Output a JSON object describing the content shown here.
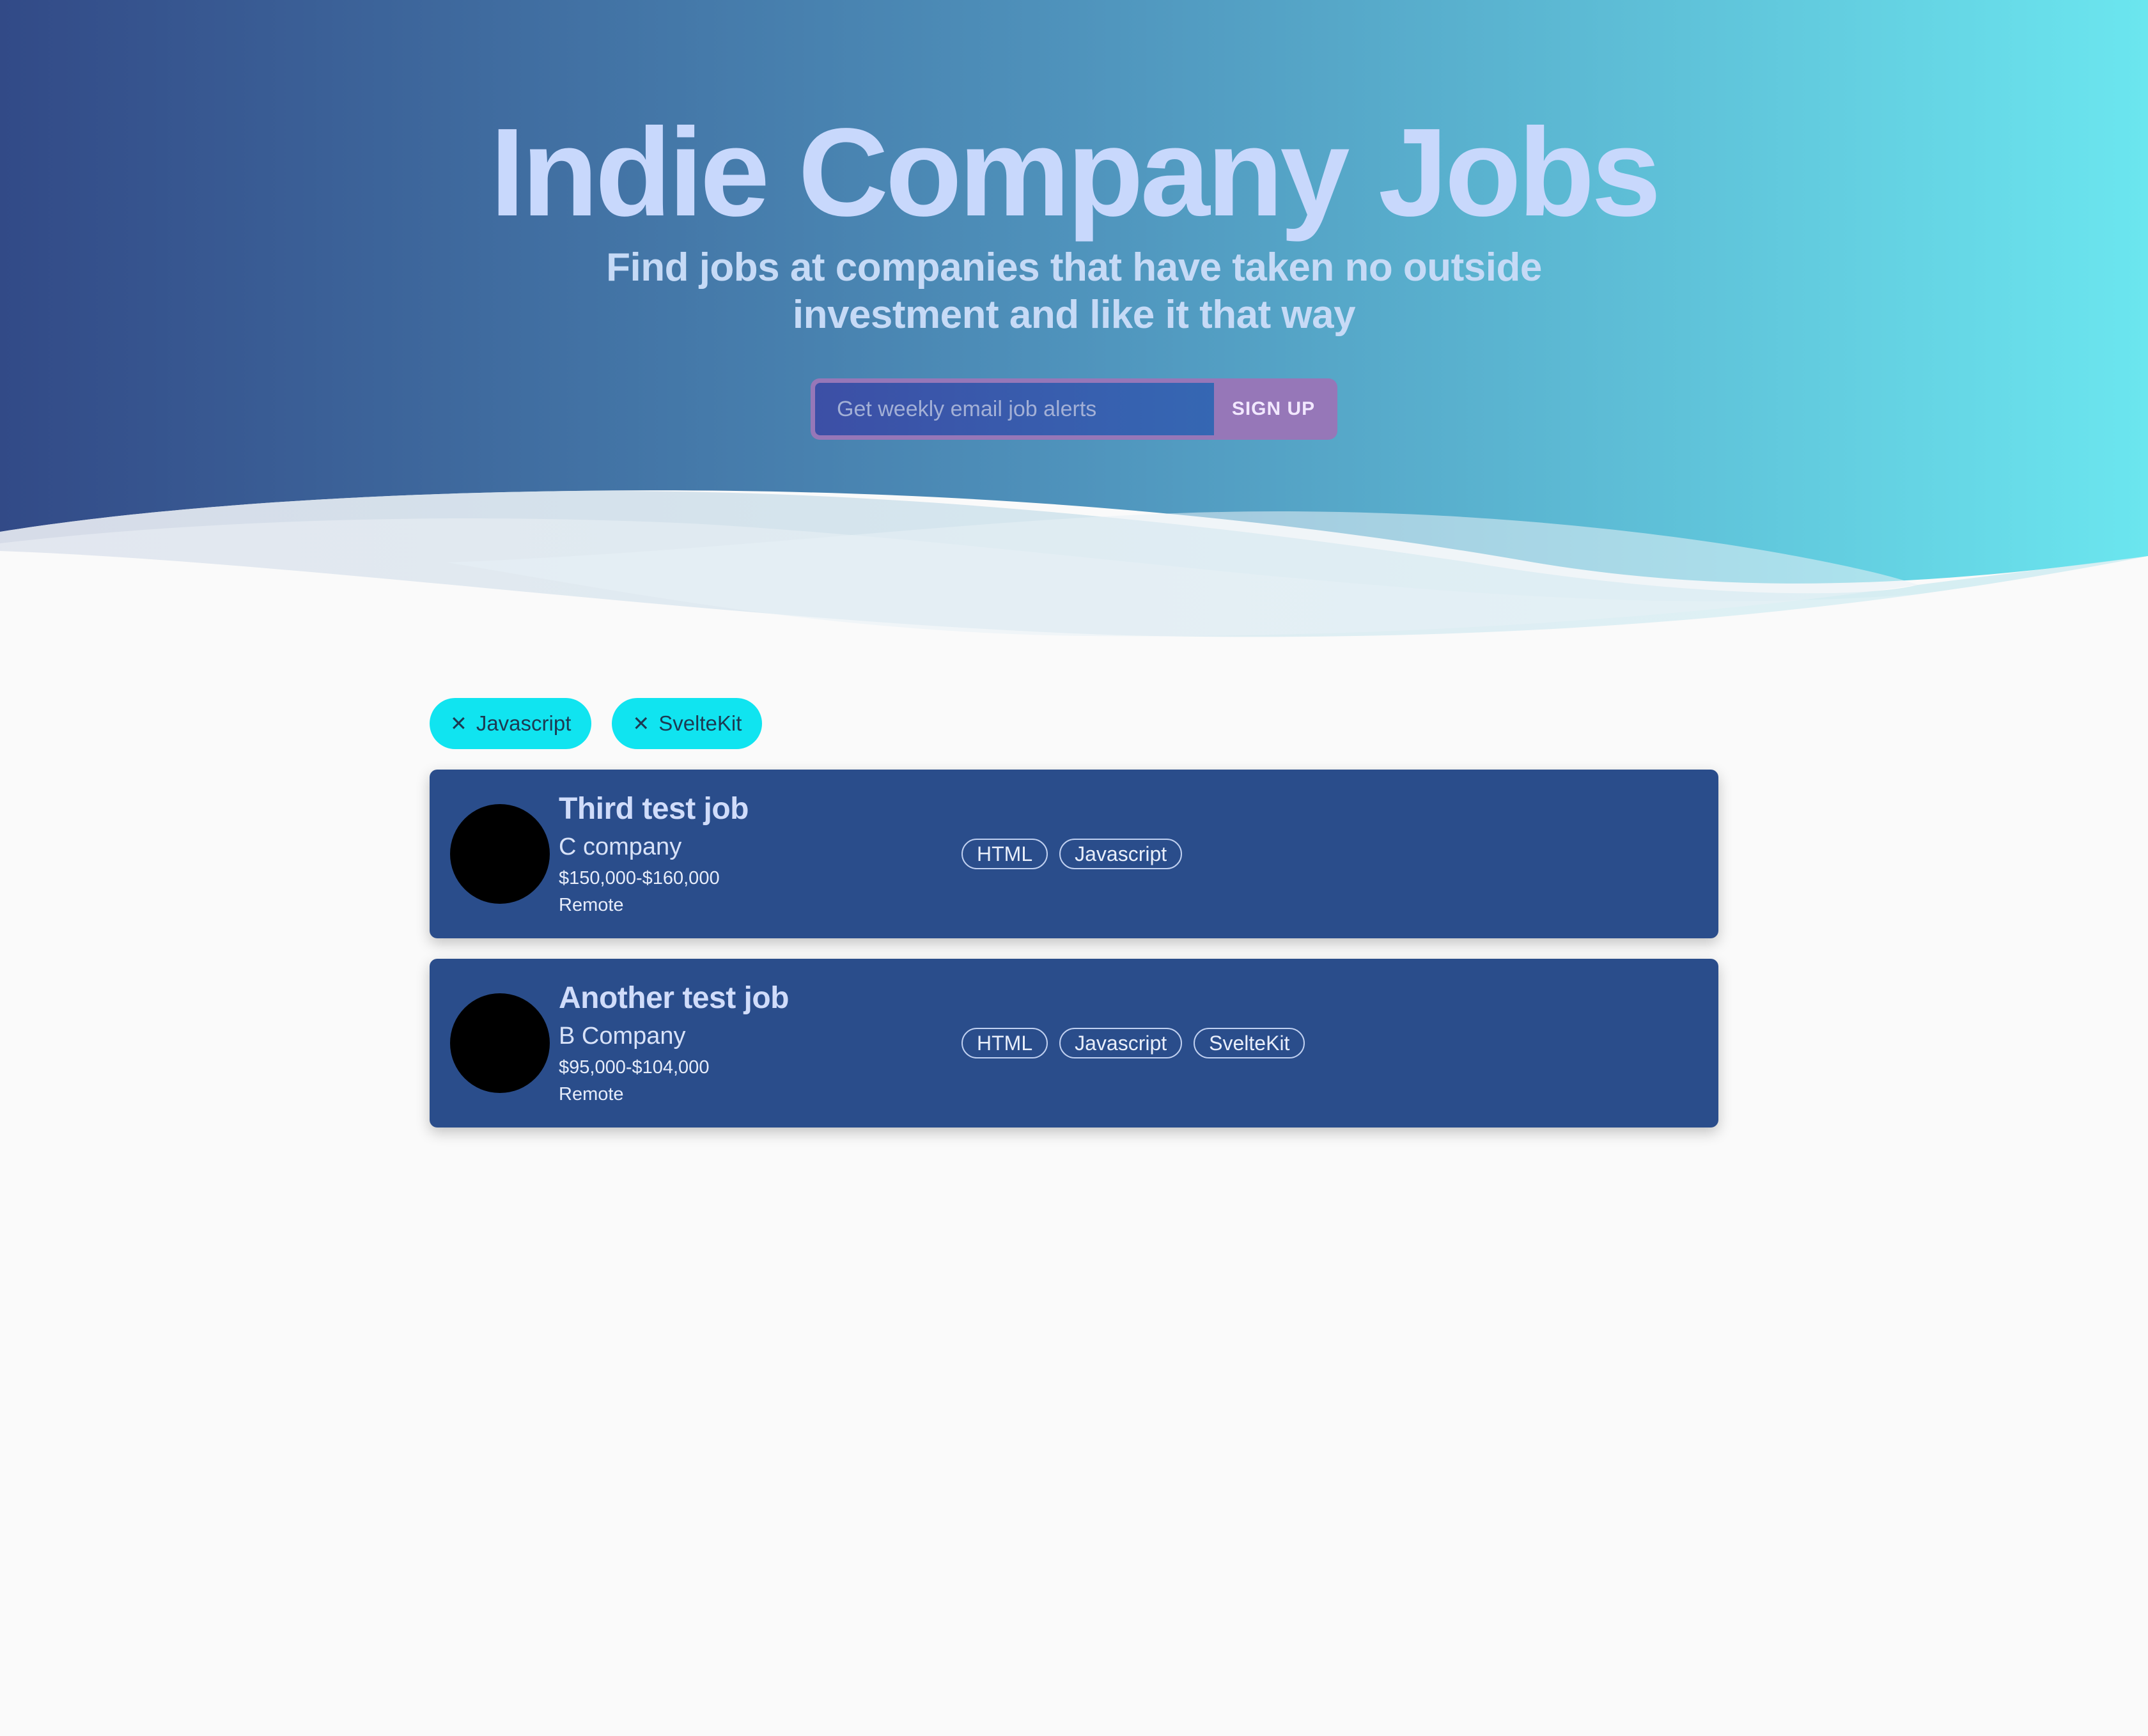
{
  "hero": {
    "title": "Indie Company Jobs",
    "subtitle": "Find jobs at companies that have taken no outside investment and like it that way",
    "signup": {
      "placeholder": "Get weekly email job alerts",
      "button_label": "SIGN UP"
    },
    "colors": {
      "gradient_start": "#324a87",
      "gradient_end": "#6be6ef",
      "title": "#c8d8fc",
      "signup_button": "#9677b8"
    }
  },
  "filters": [
    {
      "icon": "close-icon",
      "label": "Javascript"
    },
    {
      "icon": "close-icon",
      "label": "SvelteKit"
    }
  ],
  "jobs": [
    {
      "title": "Third test job",
      "company": "C company",
      "salary": "$150,000-$160,000",
      "location": "Remote",
      "tags": [
        "HTML",
        "Javascript"
      ]
    },
    {
      "title": "Another test job",
      "company": "B Company",
      "salary": "$95,000-$104,000",
      "location": "Remote",
      "tags": [
        "HTML",
        "Javascript",
        "SvelteKit"
      ]
    }
  ],
  "colors": {
    "page_background": "#fafafa",
    "filter_chip": "#10e4f0",
    "job_card": "#2a4d8b"
  }
}
